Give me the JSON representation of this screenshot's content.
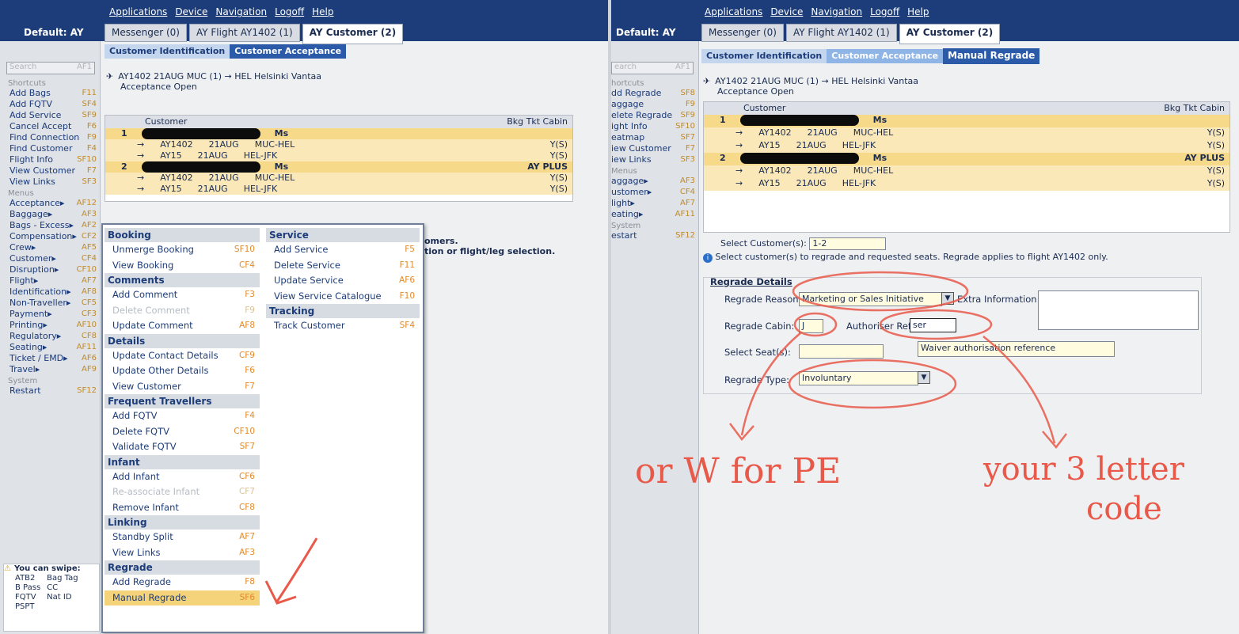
{
  "app": {
    "menu": [
      "Applications",
      "Device",
      "Navigation",
      "Logoff",
      "Help"
    ],
    "default_label": "Default: AY",
    "tabs": [
      "Messenger (0)",
      "AY Flight AY1402 (1)",
      "AY Customer (2)"
    ]
  },
  "left": {
    "breadcrumbs": [
      "Customer Identification",
      "Customer Acceptance"
    ],
    "search_placeholder": "Search",
    "search_key": "AF1",
    "shortcuts_heading": "Shortcuts",
    "shortcuts": [
      {
        "label": "Add Bags",
        "key": "F11"
      },
      {
        "label": "Add FQTV",
        "key": "SF4"
      },
      {
        "label": "Add Service",
        "key": "SF9"
      },
      {
        "label": "Cancel Accept",
        "key": "F6"
      },
      {
        "label": "Find Connection",
        "key": "F9"
      },
      {
        "label": "Find Customer",
        "key": "F4"
      },
      {
        "label": "Flight Info",
        "key": "SF10"
      },
      {
        "label": "View Customer",
        "key": "F7"
      },
      {
        "label": "View Links",
        "key": "SF3"
      }
    ],
    "menus_heading": "Menus",
    "menus": [
      {
        "label": "Acceptance▸",
        "key": "AF12"
      },
      {
        "label": "Baggage▸",
        "key": "AF3"
      },
      {
        "label": "Bags - Excess▸",
        "key": "AF2"
      },
      {
        "label": "Compensation▸",
        "key": "CF2"
      },
      {
        "label": "Crew▸",
        "key": "AF5"
      },
      {
        "label": "Customer▸",
        "key": "CF4"
      },
      {
        "label": "Disruption▸",
        "key": "CF10"
      },
      {
        "label": "Flight▸",
        "key": "AF7"
      },
      {
        "label": "Identification▸",
        "key": "AF8"
      },
      {
        "label": "Non-Traveller▸",
        "key": "CF5"
      },
      {
        "label": "Payment▸",
        "key": "CF3"
      },
      {
        "label": "Printing▸",
        "key": "AF10"
      },
      {
        "label": "Regulatory▸",
        "key": "CF8"
      },
      {
        "label": "Seating▸",
        "key": "AF11"
      },
      {
        "label": "Ticket / EMD▸",
        "key": "AF6"
      },
      {
        "label": "Travel▸",
        "key": "AF9"
      }
    ],
    "system_heading": "System",
    "system": [
      {
        "label": "Restart",
        "key": "SF12"
      }
    ],
    "flight_line": "AY1402     21AUG MUC (1) → HEL Helsinki Vantaa",
    "status": "Acceptance Open",
    "table_header": {
      "customer": "Customer",
      "right": "Bkg Tkt Cabin"
    },
    "customers": [
      {
        "num": "1",
        "title": "Ms",
        "plus": "",
        "segs": [
          {
            "flt": "AY1402",
            "date": "21AUG",
            "route": "MUC-HEL",
            "cabin": "Y(S)"
          },
          {
            "flt": "AY15",
            "date": "21AUG",
            "route": "HEL-JFK",
            "cabin": "Y(S)"
          }
        ]
      },
      {
        "num": "2",
        "title": "Ms",
        "plus": "AY PLUS",
        "segs": [
          {
            "flt": "AY1402",
            "date": "21AUG",
            "route": "MUC-HEL",
            "cabin": "Y(S)"
          },
          {
            "flt": "AY15",
            "date": "21AUG",
            "route": "HEL-JFK",
            "cabin": "Y(S)"
          }
        ]
      }
    ],
    "behind_text": [
      "omers.",
      "tion or flight/leg selection."
    ],
    "context_menu": {
      "col1": [
        {
          "type": "head",
          "label": "Booking"
        },
        {
          "label": "Unmerge Booking",
          "key": "SF10"
        },
        {
          "label": "View Booking",
          "key": "CF4"
        },
        {
          "type": "head",
          "label": "Comments"
        },
        {
          "label": "Add Comment",
          "key": "F3"
        },
        {
          "label": "Delete Comment",
          "key": "F9",
          "disabled": true
        },
        {
          "label": "Update Comment",
          "key": "AF8"
        },
        {
          "type": "head",
          "label": "Details"
        },
        {
          "label": "Update Contact Details",
          "key": "CF9"
        },
        {
          "label": "Update Other Details",
          "key": "F6"
        },
        {
          "label": "View Customer",
          "key": "F7"
        },
        {
          "type": "head",
          "label": "Frequent Travellers"
        },
        {
          "label": "Add FQTV",
          "key": "F4"
        },
        {
          "label": "Delete FQTV",
          "key": "CF10"
        },
        {
          "label": "Validate FQTV",
          "key": "SF7"
        },
        {
          "type": "head",
          "label": "Infant"
        },
        {
          "label": "Add Infant",
          "key": "CF6"
        },
        {
          "label": "Re-associate Infant",
          "key": "CF7",
          "disabled": true
        },
        {
          "label": "Remove Infant",
          "key": "CF8"
        },
        {
          "type": "head",
          "label": "Linking"
        },
        {
          "label": "Standby Split",
          "key": "AF7"
        },
        {
          "label": "View Links",
          "key": "AF3"
        },
        {
          "type": "head",
          "label": "Regrade"
        },
        {
          "label": "Add Regrade",
          "key": "F8"
        },
        {
          "label": "Manual Regrade",
          "key": "SF6",
          "selected": true
        }
      ],
      "col2": [
        {
          "type": "head",
          "label": "Service"
        },
        {
          "label": "Add Service",
          "key": "F5"
        },
        {
          "label": "Delete Service",
          "key": "F11"
        },
        {
          "label": "Update Service",
          "key": "AF6"
        },
        {
          "label": "View Service Catalogue",
          "key": "F10"
        },
        {
          "type": "head",
          "label": "Tracking"
        },
        {
          "label": "Track Customer",
          "key": "SF4"
        }
      ]
    },
    "swipe": {
      "title": "You can swipe:",
      "items": [
        [
          "ATB2",
          "Bag Tag"
        ],
        [
          "B Pass",
          "CC"
        ],
        [
          "FQTV",
          "Nat ID"
        ],
        [
          "PSPT",
          ""
        ]
      ]
    }
  },
  "right": {
    "breadcrumbs": [
      "Customer Identification",
      "Customer Acceptance",
      "Manual Regrade"
    ],
    "search_placeholder": "earch",
    "search_key": "AF1",
    "shortcuts_heading": "hortcuts",
    "shortcuts": [
      {
        "label": "dd Regrade",
        "key": "SF8"
      },
      {
        "label": "aggage",
        "key": "F9"
      },
      {
        "label": "elete Regrade",
        "key": "SF9"
      },
      {
        "label": "ight Info",
        "key": "SF10"
      },
      {
        "label": "eatmap",
        "key": "SF7"
      },
      {
        "label": "iew Customer",
        "key": "F7"
      },
      {
        "label": "iew Links",
        "key": "SF3"
      }
    ],
    "menus_heading": "Menus",
    "menus": [
      {
        "label": "aggage▸",
        "key": "AF3"
      },
      {
        "label": "ustomer▸",
        "key": "CF4"
      },
      {
        "label": "light▸",
        "key": "AF7"
      },
      {
        "label": "eating▸",
        "key": "AF11"
      }
    ],
    "system_heading": "System",
    "system": [
      {
        "label": "estart",
        "key": "SF12"
      }
    ],
    "flight_line": "AY1402     21AUG MUC (1) → HEL Helsinki Vantaa",
    "status": "Acceptance Open",
    "select_customers_label": "Select Customer(s):",
    "select_customers_value": "1-2",
    "info_text": "Select customer(s) to regrade and requested seats. Regrade applies to flight AY1402 only.",
    "regrade": {
      "heading": "Regrade Details",
      "reason_label": "Regrade Reason:",
      "reason_value": "Marketing or Sales Initiative",
      "extra_label": "Extra Information:",
      "cabin_label": "Regrade Cabin:",
      "cabin_value": "J",
      "auth_label": "Authoriser Ref:",
      "auth_value": "ser",
      "seat_label": "Select Seat(s):",
      "seat_value": "",
      "waiver_label": "Waiver authorisation reference",
      "type_label": "Regrade Type:",
      "type_value": "Involuntary"
    },
    "annotations": {
      "left": "or W for PE",
      "right_line1": "your 3 letter",
      "right_line2": "code"
    }
  }
}
